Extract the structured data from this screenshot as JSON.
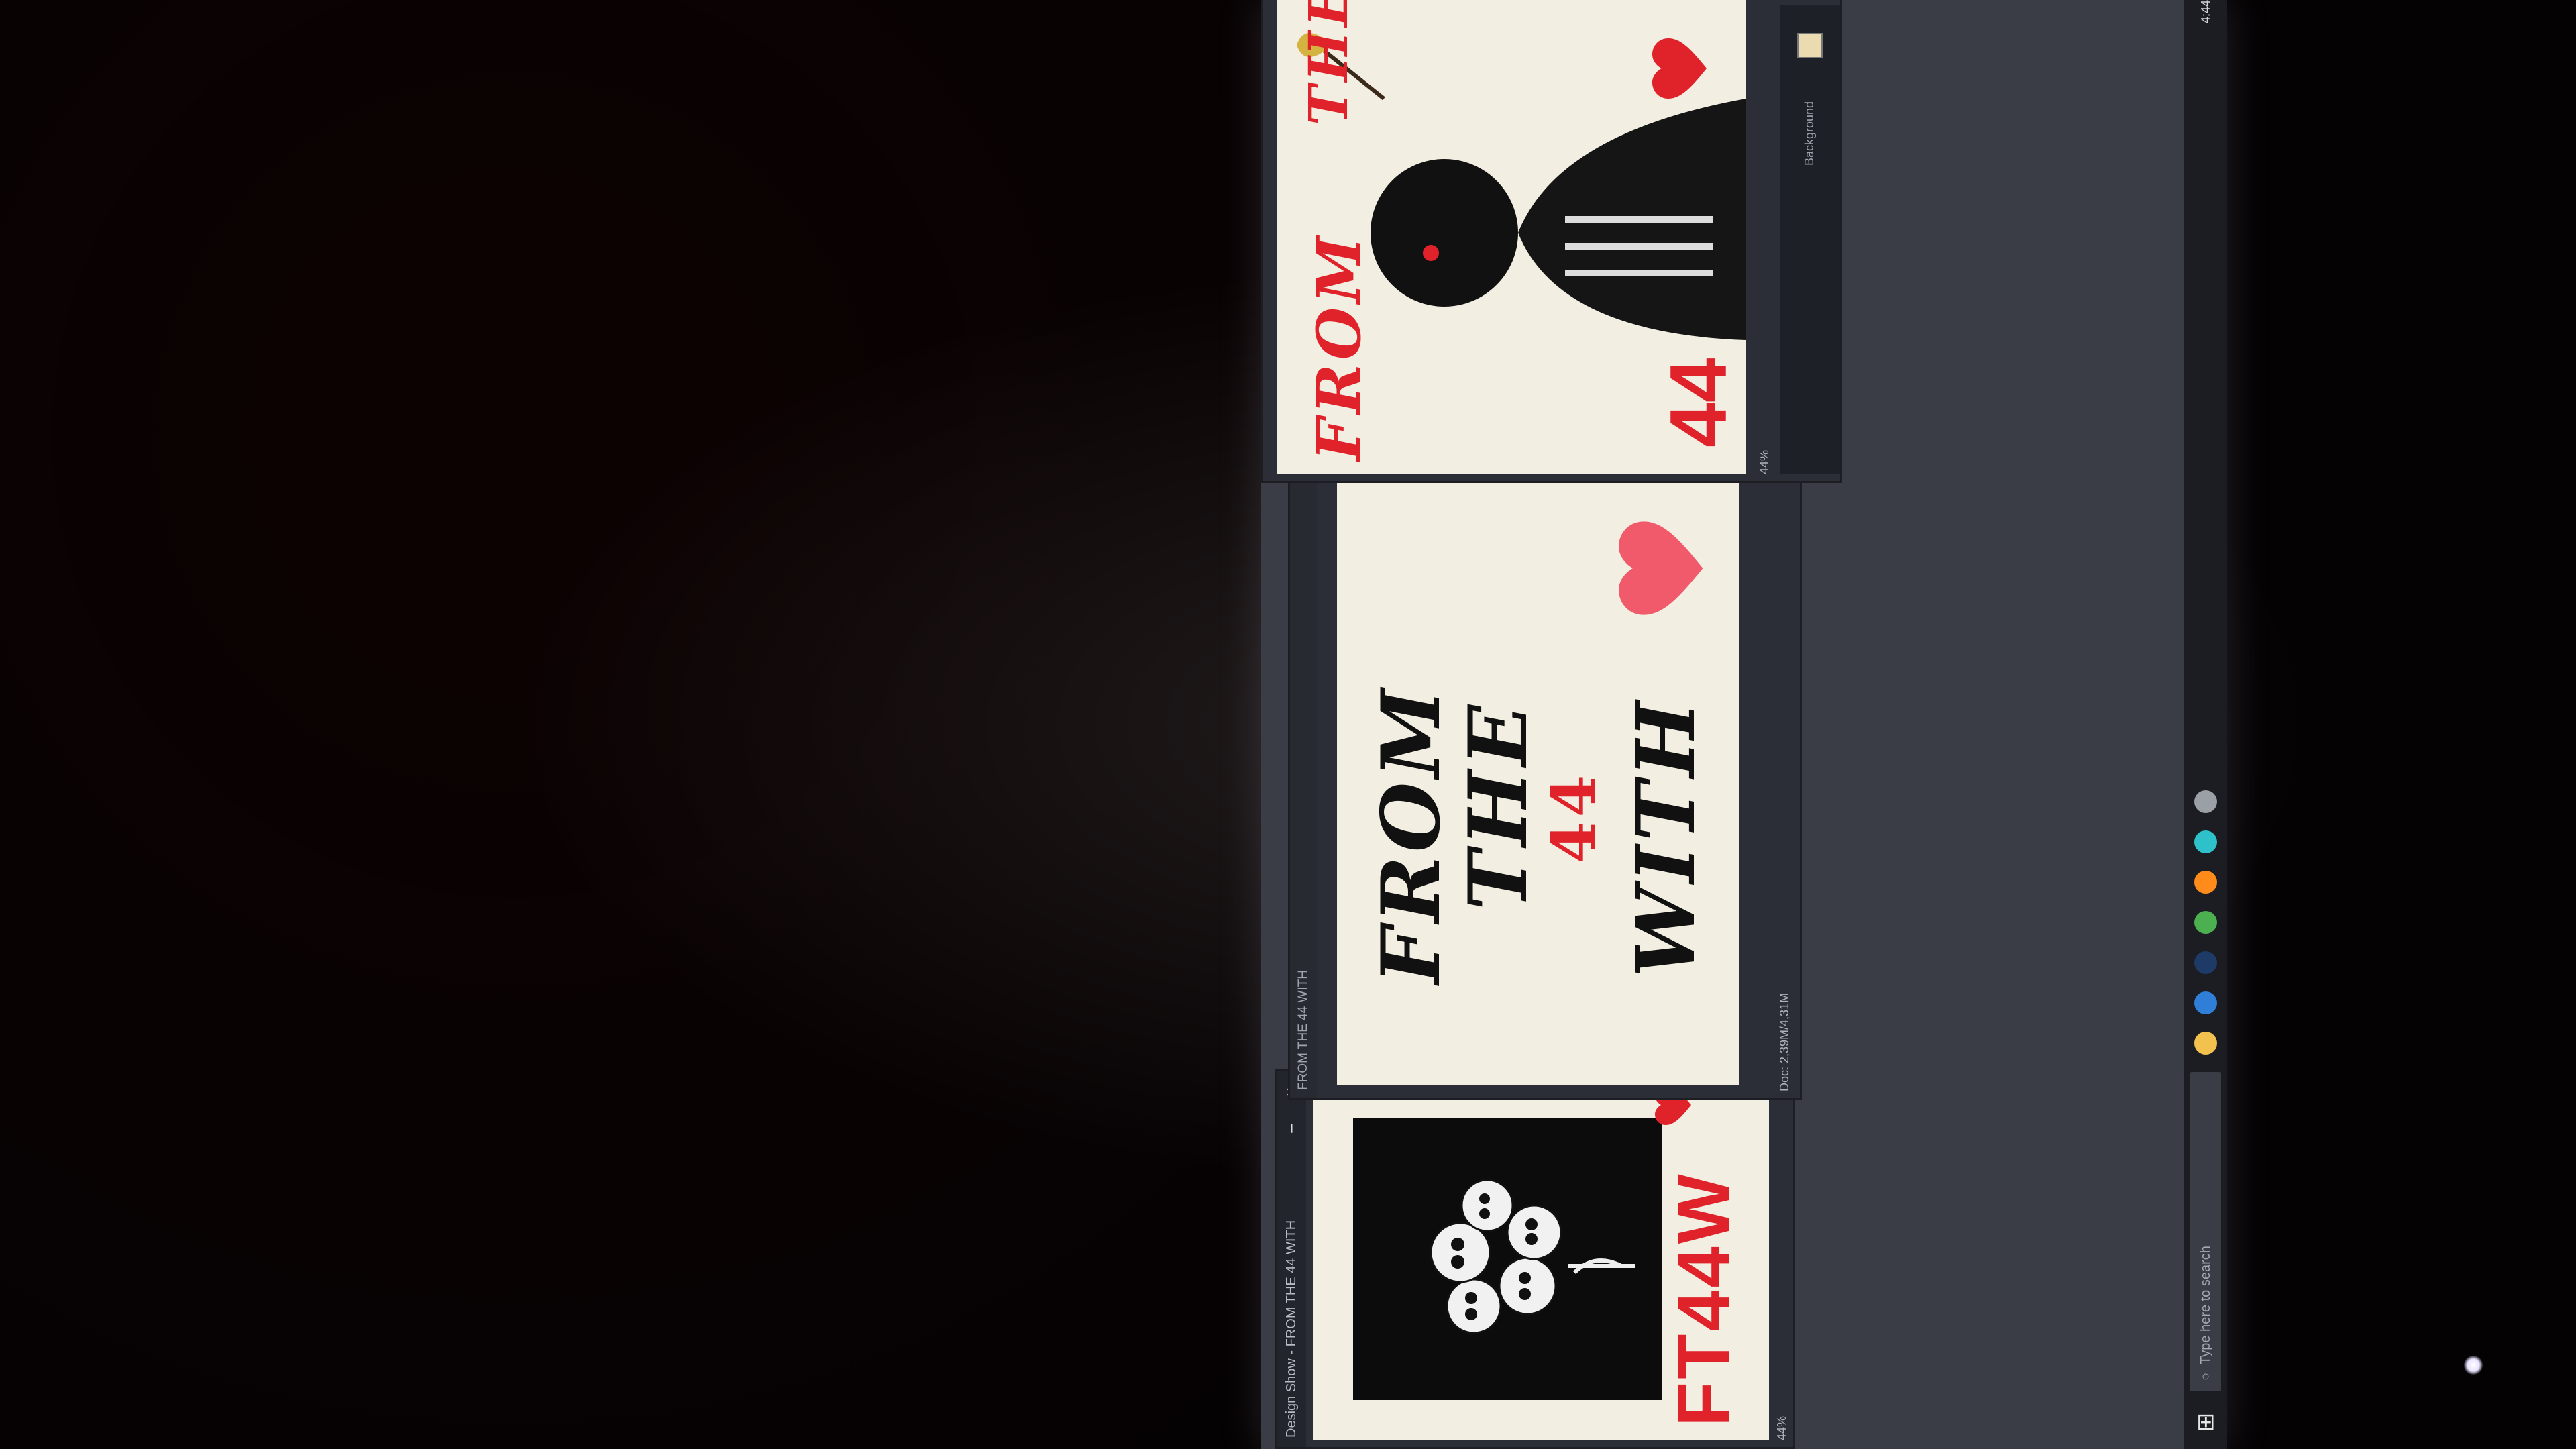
{
  "photo_context": "dark room photo of rotated monitor",
  "windows": {
    "left": {
      "title": "Design Show - FROM THE 44 WITH",
      "close_glyph": "×",
      "minimize_glyph": "–",
      "status": "44%"
    },
    "middle": {
      "doc_tab": "FROM THE 44 WITH",
      "status": "Doc: 2,39M/4,31M"
    },
    "right": {
      "panel_label": "Background",
      "status": "44%"
    }
  },
  "artwork": {
    "poster_left": {
      "brand_text": "FT44W",
      "line_color": "#e0232b"
    },
    "poster_middle": {
      "line1": "FROM",
      "line2": "THE",
      "line3": "44",
      "line4": "WITH"
    },
    "poster_right": {
      "script_top": "FROM",
      "number": "44",
      "script_tail": "THE"
    }
  },
  "taskbar": {
    "search_placeholder": "Type here to search",
    "start_glyph": "⊞",
    "apps": [
      {
        "name": "folder-icon",
        "color": "#f2c14e"
      },
      {
        "name": "store-icon",
        "color": "#2f7ed8"
      },
      {
        "name": "photoshop-icon",
        "color": "#1e3a66"
      },
      {
        "name": "chrome-icon",
        "color": "#4caf50"
      },
      {
        "name": "firefox-icon",
        "color": "#ff8c1a"
      },
      {
        "name": "app-icon",
        "color": "#2ec1c9"
      },
      {
        "name": "settings-icon",
        "color": "#9aa0a6"
      }
    ],
    "time": "4:44"
  },
  "colors": {
    "background": "#040203",
    "canvas": "#f2eee2",
    "accent_red": "#e0232b",
    "heart_pink": "#f05a6b"
  }
}
